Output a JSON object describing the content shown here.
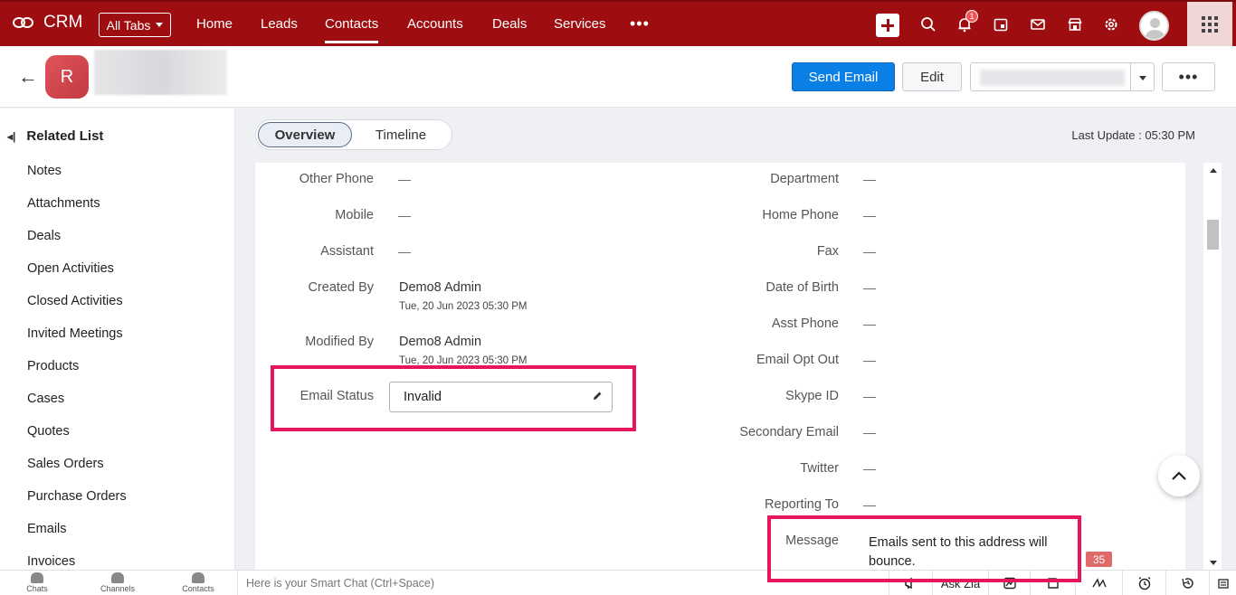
{
  "app": {
    "name": "CRM"
  },
  "topnav": {
    "all_tabs": "All Tabs",
    "tabs": [
      "Home",
      "Leads",
      "Contacts",
      "Accounts",
      "Deals",
      "Services"
    ],
    "more": "•••",
    "notification_count": "1"
  },
  "record": {
    "avatar_letter": "R",
    "send_email": "Send Email",
    "edit": "Edit",
    "more": "•••"
  },
  "sidebar": {
    "title": "Related List",
    "items": [
      "Notes",
      "Attachments",
      "Deals",
      "Open Activities",
      "Closed Activities",
      "Invited Meetings",
      "Products",
      "Cases",
      "Quotes",
      "Sales Orders",
      "Purchase Orders",
      "Emails",
      "Invoices"
    ]
  },
  "view_tabs": {
    "overview": "Overview",
    "timeline": "Timeline"
  },
  "last_update": "Last Update : 05:30 PM",
  "left_fields": {
    "other_phone": {
      "label": "Other Phone",
      "value": "—"
    },
    "mobile": {
      "label": "Mobile",
      "value": "—"
    },
    "assistant": {
      "label": "Assistant",
      "value": "—"
    },
    "created_by": {
      "label": "Created By",
      "value": "Demo8 Admin",
      "date": "Tue, 20 Jun 2023 05:30 PM"
    },
    "modified_by": {
      "label": "Modified By",
      "value": "Demo8 Admin",
      "date": "Tue, 20 Jun 2023 05:30 PM"
    },
    "email_status": {
      "label": "Email Status",
      "value": "Invalid"
    }
  },
  "right_fields": {
    "department": {
      "label": "Department",
      "value": "—"
    },
    "home_phone": {
      "label": "Home Phone",
      "value": "—"
    },
    "fax": {
      "label": "Fax",
      "value": "—"
    },
    "date_of_birth": {
      "label": "Date of Birth",
      "value": "—"
    },
    "asst_phone": {
      "label": "Asst Phone",
      "value": "—"
    },
    "email_opt_out": {
      "label": "Email Opt Out",
      "value": "—"
    },
    "skype_id": {
      "label": "Skype ID",
      "value": "—"
    },
    "secondary_email": {
      "label": "Secondary Email",
      "value": "—"
    },
    "twitter": {
      "label": "Twitter",
      "value": "—"
    },
    "reporting_to": {
      "label": "Reporting To",
      "value": "—"
    },
    "message": {
      "label": "Message",
      "value": "Emails sent to this address will bounce."
    }
  },
  "bottombar": {
    "chats": "Chats",
    "channels": "Channels",
    "contacts": "Contacts",
    "chat_placeholder": "Here is your Smart Chat (Ctrl+Space)",
    "ask_zia": "Ask Zia",
    "badge": "35"
  },
  "colors": {
    "topbar": "#9e0e10",
    "primary_button": "#0a7fe6",
    "highlight": "#e5175a"
  }
}
